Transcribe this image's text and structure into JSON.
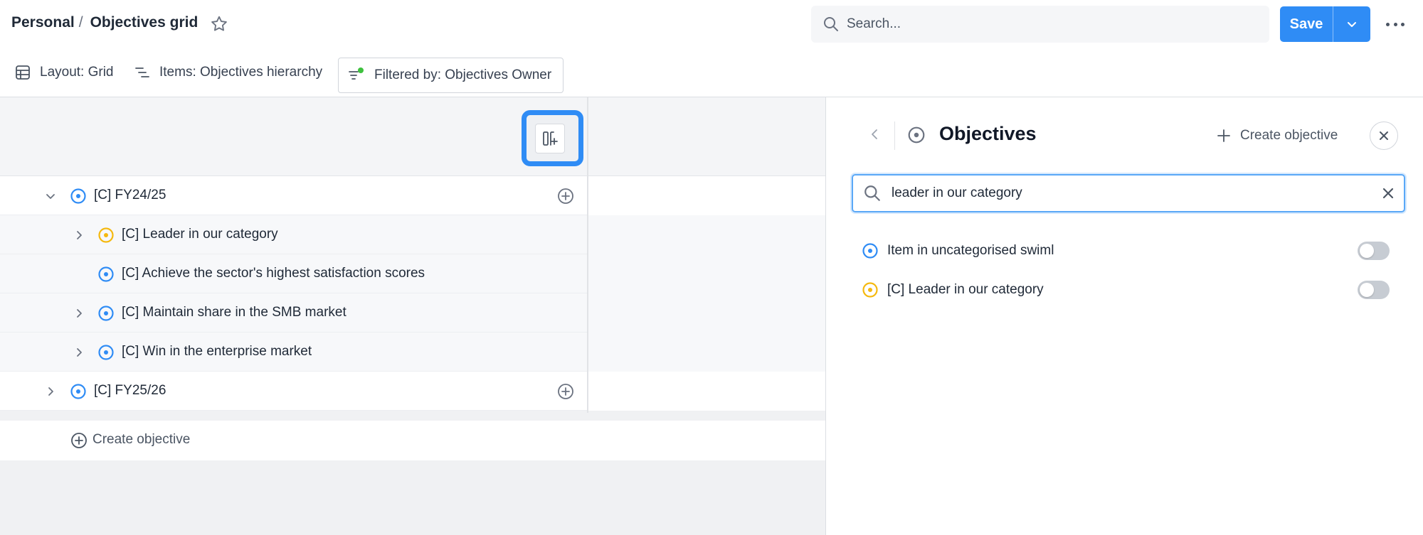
{
  "breadcrumb": {
    "parent": "Personal",
    "separator": "/",
    "current": "Objectives grid"
  },
  "search": {
    "placeholder": "Search..."
  },
  "actions": {
    "save_label": "Save"
  },
  "toolbar": {
    "layout_label": "Layout: Grid",
    "items_label": "Items: Objectives hierarchy",
    "filter_label": "Filtered by: Objectives Owner"
  },
  "grid": {
    "rows": [
      {
        "label": "[C] FY24/25",
        "level": 0,
        "expanded": true,
        "icon": "objective-blue-icon"
      },
      {
        "label": "[C] Leader in our category",
        "level": 1,
        "expanded": false,
        "icon": "objective-yellow-icon"
      },
      {
        "label": "[C] Achieve the sector's highest satisfaction scores",
        "level": 1,
        "expanded": null,
        "icon": "objective-blue-icon"
      },
      {
        "label": "[C] Maintain share in the SMB market",
        "level": 1,
        "expanded": false,
        "icon": "objective-blue-icon"
      },
      {
        "label": "[C] Win in the enterprise market",
        "level": 1,
        "expanded": false,
        "icon": "objective-blue-icon"
      },
      {
        "label": "[C] FY25/26",
        "level": 0,
        "expanded": false,
        "icon": "objective-blue-icon"
      }
    ],
    "create_label": "Create objective"
  },
  "panel": {
    "title": "Objectives",
    "create_label": "Create objective",
    "search_value": "leader in our category",
    "results": [
      {
        "label": "Item in uncategorised swiml",
        "icon": "objective-blue-icon",
        "enabled": false
      },
      {
        "label": "[C] Leader in our category",
        "icon": "objective-yellow-icon",
        "enabled": false
      }
    ]
  },
  "colors": {
    "accent": "#2f8cf5",
    "objective_blue": "#2f8cf5",
    "objective_yellow": "#f5b90f",
    "filter_dot": "#3ec13e"
  }
}
